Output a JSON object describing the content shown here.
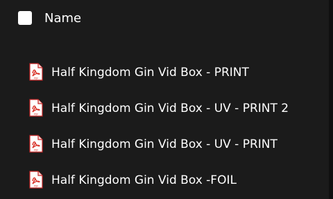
{
  "header": {
    "column_label": "Name",
    "select_all_checked": false
  },
  "files": [
    {
      "name": "Half Kingdom Gin Vid Box - PRINT",
      "icon": "pdf-file-icon",
      "icon_label": "PDF"
    },
    {
      "name": "Half Kingdom Gin Vid Box - UV - PRINT 2",
      "icon": "pdf-file-icon",
      "icon_label": "PDF"
    },
    {
      "name": "Half Kingdom Gin Vid Box - UV - PRINT",
      "icon": "pdf-file-icon",
      "icon_label": "PDF"
    },
    {
      "name": "Half Kingdom Gin Vid Box -FOIL",
      "icon": "pdf-file-icon",
      "icon_label": "PDF"
    }
  ],
  "colors": {
    "background": "#1b1b1b",
    "text": "#ffffff",
    "pdf_red": "#d9342b"
  }
}
